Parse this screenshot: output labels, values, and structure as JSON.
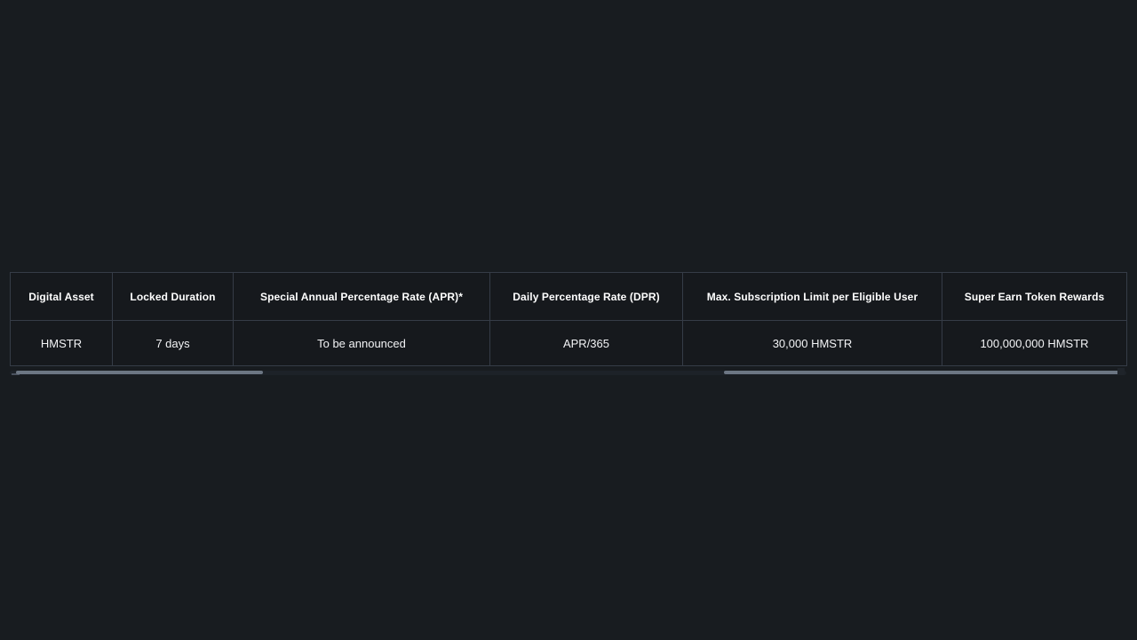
{
  "theme": {
    "page_background": "#181c20",
    "cell_background": "#16191d",
    "border_color": "#353c47",
    "text_color": "#ffffff",
    "scrollbar_thumb": "#6c7683",
    "scrollbar_track": "#1d2228"
  },
  "table": {
    "name": "super-earn-details-table",
    "columns": [
      {
        "key": "digital_asset",
        "header": "Digital Asset"
      },
      {
        "key": "locked_duration",
        "header": "Locked Duration"
      },
      {
        "key": "special_apr",
        "header": "Special Annual Percentage Rate (APR)*"
      },
      {
        "key": "dpr",
        "header": "Daily Percentage Rate (DPR)"
      },
      {
        "key": "max_subscription",
        "header": "Max. Subscription Limit per Eligible User"
      },
      {
        "key": "token_rewards",
        "header": "Super Earn Token Rewards"
      }
    ],
    "rows": [
      {
        "digital_asset": "HMSTR",
        "locked_duration": "7 days",
        "special_apr": "To be announced",
        "dpr": "APR/365",
        "max_subscription": "30,000 HMSTR",
        "token_rewards": "100,000,000 HMSTR"
      }
    ]
  },
  "scrollbar": {
    "orientation": "horizontal",
    "name": "table-horizontal-scrollbar"
  }
}
